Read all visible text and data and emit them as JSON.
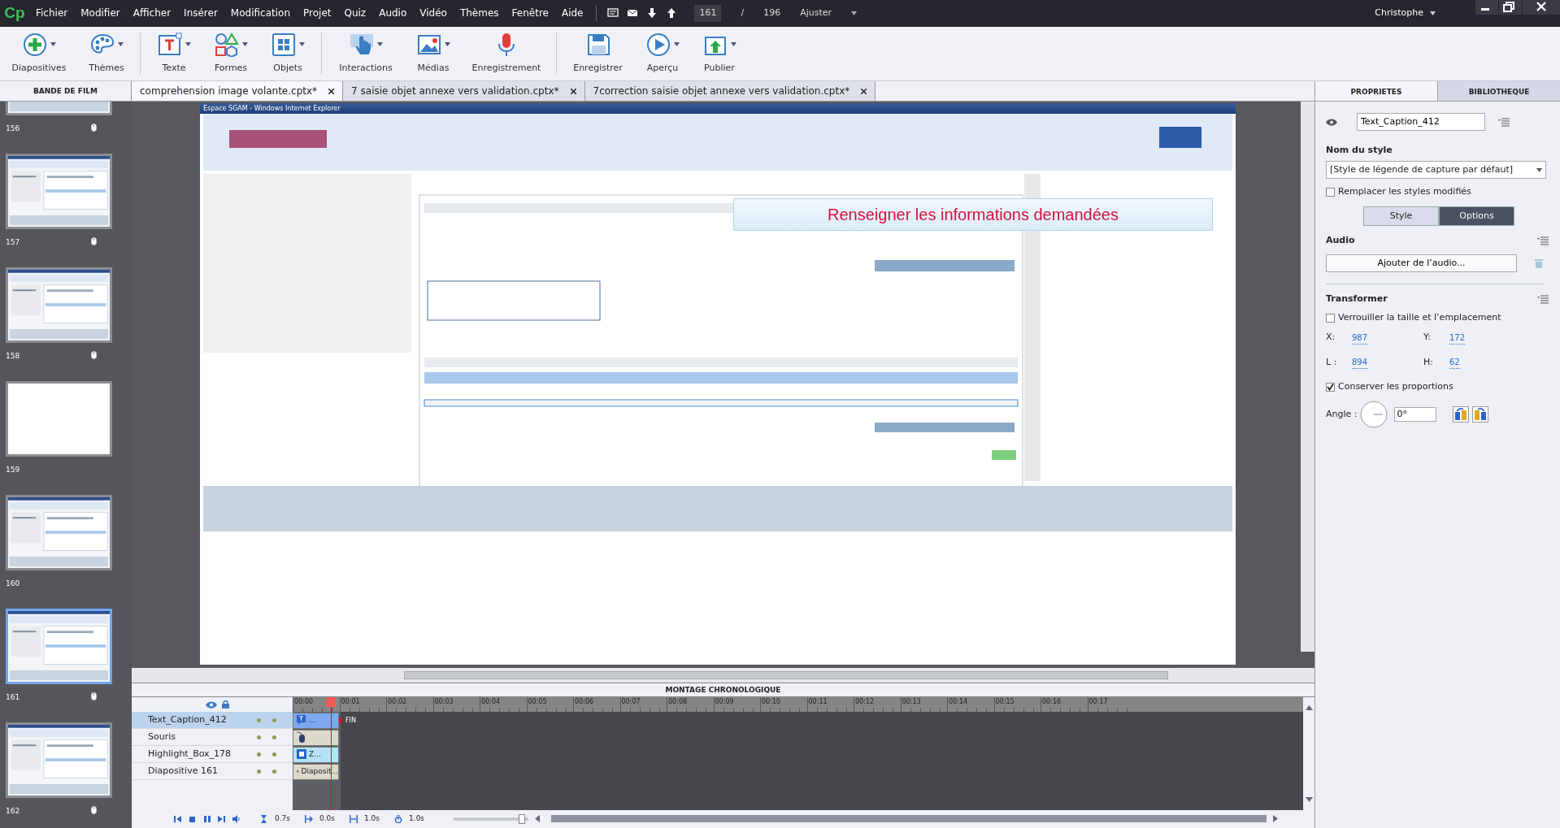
{
  "app": {
    "logo": "Cp"
  },
  "menu": [
    "Fichier",
    "Modifier",
    "Afficher",
    "Insérer",
    "Modification",
    "Projet",
    "Quiz",
    "Audio",
    "Vidéo",
    "Thèmes",
    "Fenêtre",
    "Aide"
  ],
  "slide_nav": {
    "current": "161",
    "separator": "/",
    "total": "196",
    "zoom": "Ajuster"
  },
  "user": "Christophe",
  "toolbar": [
    [
      {
        "label": "Diapositives",
        "dropdown": true
      },
      {
        "label": "Thèmes",
        "dropdown": true
      }
    ],
    [
      {
        "label": "Texte",
        "dropdown": true
      },
      {
        "label": "Formes",
        "dropdown": true
      },
      {
        "label": "Objets",
        "dropdown": true
      }
    ],
    [
      {
        "label": "Interactions",
        "dropdown": true
      },
      {
        "label": "Médias",
        "dropdown": true
      },
      {
        "label": "Enregistrement",
        "dropdown": false
      }
    ],
    [
      {
        "label": "Enregistrer",
        "dropdown": false
      },
      {
        "label": "Aperçu",
        "dropdown": true
      },
      {
        "label": "Publier",
        "dropdown": true
      }
    ]
  ],
  "filmstrip": {
    "title": "BANDE DE FILM",
    "slides": [
      {
        "number": "156",
        "kind": "screen",
        "mouse": true,
        "selected": false
      },
      {
        "number": "157",
        "kind": "screen",
        "mouse": true,
        "selected": false
      },
      {
        "number": "158",
        "kind": "screen",
        "mouse": true,
        "selected": false
      },
      {
        "number": "159",
        "kind": "blank",
        "mouse": false,
        "selected": false
      },
      {
        "number": "160",
        "kind": "screen",
        "mouse": false,
        "selected": false
      },
      {
        "number": "161",
        "kind": "screen",
        "mouse": true,
        "selected": true
      },
      {
        "number": "162",
        "kind": "screen",
        "mouse": true,
        "selected": false
      }
    ]
  },
  "doc_tabs": [
    {
      "label": "comprehension image volante.cptx*",
      "selected": true
    },
    {
      "label": "7 saisie objet annexe vers validation.cptx*",
      "selected": false
    },
    {
      "label": "7correction saisie objet annexe vers validation.cptx*",
      "selected": false
    }
  ],
  "slide": {
    "window_title": "Espace SGAM - Windows Internet Explorer",
    "caption": "Renseigner les informations demandées"
  },
  "properties": {
    "tabs": [
      {
        "label": "PROPRIETES",
        "selected": true
      },
      {
        "label": "BIBLIOTHEQUE",
        "selected": false
      }
    ],
    "name": "Text_Caption_412",
    "style_title": "Nom du style",
    "style_value": "[Style de légende de capture par défaut]",
    "replace_styles": {
      "label": "Remplacer les styles modifiés",
      "checked": false
    },
    "segments": [
      {
        "label": "Style",
        "selected": false
      },
      {
        "label": "Options",
        "selected": true
      }
    ],
    "audio": {
      "title": "Audio",
      "button": "Ajouter de l’audio..."
    },
    "transform": {
      "title": "Transformer",
      "lock": {
        "label": "Verrouiller la taille et l’emplacement",
        "checked": false
      },
      "fields": [
        {
          "label": "X:",
          "value": "987"
        },
        {
          "label": "Y:",
          "value": "172"
        },
        {
          "label": "L :",
          "value": "894"
        },
        {
          "label": "H:",
          "value": "62"
        }
      ],
      "keep_ratio": {
        "label": "Conserver les proportions",
        "checked": true
      },
      "angle_label": "Angle :",
      "angle_value": "0°"
    }
  },
  "timeline": {
    "title": "MONTAGE CHRONOLOGIQUE",
    "ticks": [
      "00:00",
      "00:01",
      "00:02",
      "00:03",
      "00:04",
      "00:05",
      "00:06",
      "00:07",
      "00:08",
      "00:09",
      "00:10",
      "00:11",
      "00:12",
      "00:13",
      "00:14",
      "00:15",
      "00:16",
      "00:17"
    ],
    "layers": [
      {
        "name": "Text_Caption_412",
        "selected": true,
        "clip": {
          "kind": "caption",
          "label": "..."
        }
      },
      {
        "name": "Souris",
        "selected": false,
        "clip": {
          "kind": "mouse"
        }
      },
      {
        "name": "Highlight_Box_178",
        "selected": false,
        "clip": {
          "kind": "highlight",
          "label": "Z..."
        }
      },
      {
        "name": "Diapositive 161",
        "selected": false,
        "clip": {
          "kind": "slide",
          "label": "Diaposit..."
        }
      }
    ],
    "end_label": "FIN",
    "timings": [
      "0.7s",
      "0.0s",
      "1.0s",
      "1.0s"
    ],
    "zoom_slider": {
      "level": 0.95
    }
  }
}
